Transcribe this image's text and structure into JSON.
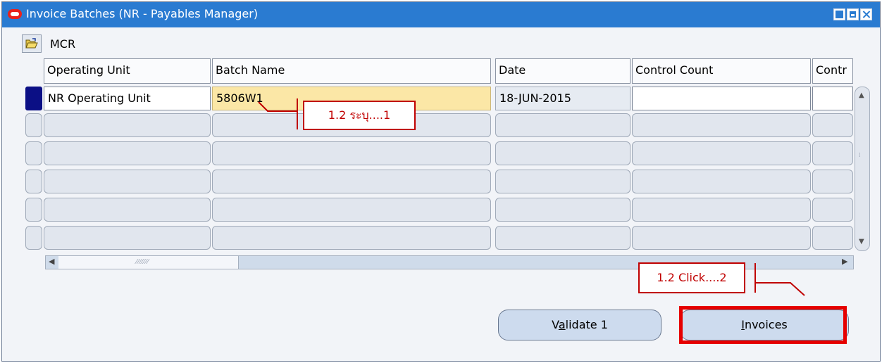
{
  "window": {
    "title": "Invoice Batches (NR - Payables Manager)",
    "icons": [
      "oracle-logo-icon",
      "minimize-icon",
      "maximize-icon",
      "close-icon"
    ]
  },
  "folder": {
    "icon": "folder-open-icon",
    "label": "MCR"
  },
  "columns": [
    "Operating Unit",
    "Batch Name",
    "Date",
    "Control Count",
    "Contr"
  ],
  "rows": [
    {
      "operating_unit": "NR Operating Unit",
      "batch_name": "5806W1",
      "date": "18-JUN-2015",
      "control_count": "",
      "control": ""
    },
    {
      "operating_unit": "",
      "batch_name": "",
      "date": "",
      "control_count": "",
      "control": ""
    },
    {
      "operating_unit": "",
      "batch_name": "",
      "date": "",
      "control_count": "",
      "control": ""
    },
    {
      "operating_unit": "",
      "batch_name": "",
      "date": "",
      "control_count": "",
      "control": ""
    },
    {
      "operating_unit": "",
      "batch_name": "",
      "date": "",
      "control_count": "",
      "control": ""
    },
    {
      "operating_unit": "",
      "batch_name": "",
      "date": "",
      "control_count": "",
      "control": ""
    }
  ],
  "buttons": {
    "validate": {
      "before": "V",
      "mnemonic": "a",
      "after": "lidate 1"
    },
    "invoices": {
      "before": "",
      "mnemonic": "I",
      "after": "nvoices"
    }
  },
  "annotations": {
    "step1": "1.2 ระบุ....1",
    "step2": "1.2 Click....2",
    "highlight_color": "#e60000"
  },
  "colors": {
    "titlebar": "#2a7bd1",
    "selected_row_marker": "#0b0f85",
    "current_field": "#fbe7a6"
  }
}
